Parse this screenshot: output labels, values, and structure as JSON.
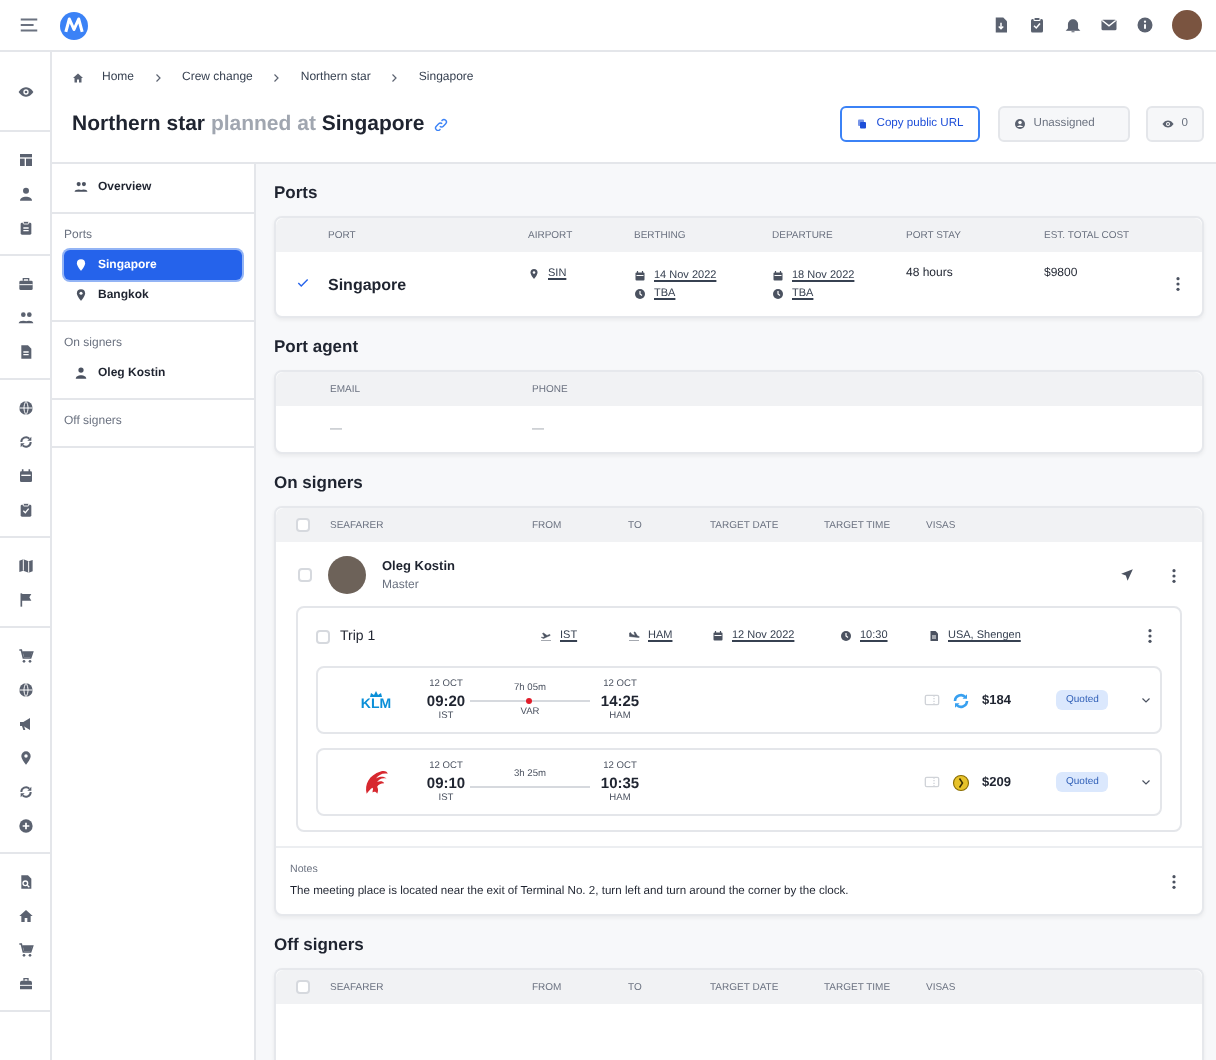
{
  "breadcrumb": [
    "Home",
    "Crew change",
    "Northern star",
    "Singapore"
  ],
  "title": {
    "vessel": "Northern star",
    "connector": "planned at",
    "port": "Singapore"
  },
  "actions": {
    "copy_url": "Copy public URL",
    "assignee": "Unassigned",
    "watchers": "0"
  },
  "sidebar": {
    "overview": "Overview",
    "sections": [
      {
        "title": "Ports",
        "items": [
          {
            "label": "Singapore",
            "kind": "port",
            "selected": true
          },
          {
            "label": "Bangkok",
            "kind": "port",
            "selected": false
          }
        ]
      },
      {
        "title": "On signers",
        "items": [
          {
            "label": "Oleg Kostin",
            "kind": "person",
            "selected": false
          }
        ]
      },
      {
        "title": "Off signers"
      }
    ]
  },
  "ports": {
    "title": "Ports",
    "columns": [
      "PORT",
      "AIRPORT",
      "BERTHING",
      "DEPARTURE",
      "PORT STAY",
      "EST. TOTAL COST"
    ],
    "rows": [
      {
        "checked": true,
        "port": "Singapore",
        "airport": "SIN",
        "berthing_date": "14 Nov 2022",
        "berthing_time": "TBA",
        "departure_date": "18 Nov 2022",
        "departure_time": "TBA",
        "port_stay": "48 hours",
        "cost": "$9800"
      }
    ]
  },
  "port_agent": {
    "title": "Port agent",
    "columns": [
      "EMAIL",
      "PHONE"
    ],
    "rows": [
      [
        "—",
        "—"
      ]
    ]
  },
  "on_signers": {
    "title": "On signers",
    "select_all_checked": false,
    "columns": [
      "SEAFARER",
      "FROM",
      "TO",
      "TARGET DATE",
      "TARGET TIME",
      "VISAS"
    ],
    "seafarers": [
      {
        "name": "Oleg Kostin",
        "rank": "Master",
        "checked": false,
        "trips": [
          {
            "title": "Trip 1",
            "checked": false,
            "from": "IST",
            "to": "HAM",
            "date": "12 Nov 2022",
            "time": "10:30",
            "visas": "USA, Shengen",
            "flights": [
              {
                "kind": "klm",
                "logo_text": "KLM",
                "dep_date": "12 OCT",
                "dep_time": "09:20",
                "dep_airport": "IST",
                "duration": "7h 05m",
                "via": "VAR",
                "arr_date": "12 OCT",
                "arr_time": "14:25",
                "arr_airport": "HAM",
                "price": "$184",
                "status": "Quoted"
              },
              {
                "kind": "phoenix",
                "dep_date": "12 OCT",
                "dep_time": "09:10",
                "dep_airport": "IST",
                "duration": "3h 25m",
                "arr_date": "12 OCT",
                "arr_time": "10:35",
                "arr_airport": "HAM",
                "price": "$209",
                "status": "Quoted"
              }
            ]
          }
        ],
        "notes": {
          "label": "Notes",
          "text": "The meeting place is located near the exit of Terminal No. 2, turn left and turn around the corner by the clock."
        }
      }
    ]
  },
  "off_signers": {
    "title": "Off signers",
    "select_all_checked": false,
    "columns": [
      "SEAFARER",
      "FROM",
      "TO",
      "TARGET DATE",
      "TARGET TIME",
      "VISAS"
    ]
  }
}
